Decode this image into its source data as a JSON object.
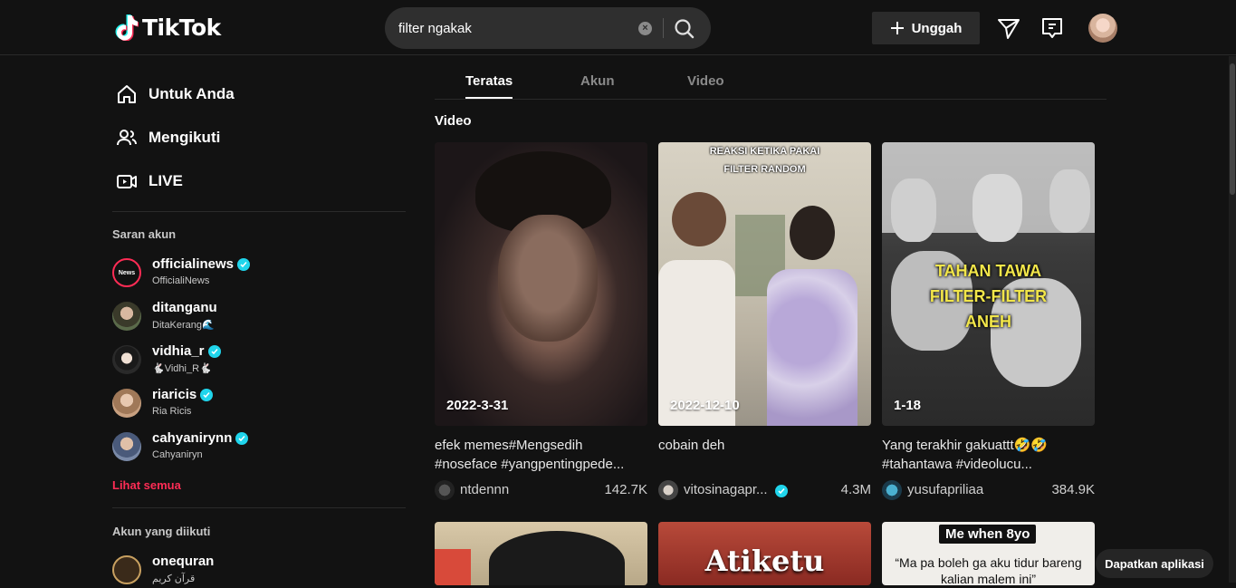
{
  "app": {
    "logo": "TikTok"
  },
  "search": {
    "value": "filter ngakak",
    "clear_icon": "×"
  },
  "header": {
    "upload_label": "Unggah"
  },
  "nav": [
    {
      "label": "Untuk Anda",
      "icon": "home-icon"
    },
    {
      "label": "Mengikuti",
      "icon": "users-icon"
    },
    {
      "label": "LIVE",
      "icon": "live-icon"
    }
  ],
  "suggested": {
    "title": "Saran akun",
    "accounts": [
      {
        "name": "officialinews",
        "sub": "OfficialiNews",
        "verified": true,
        "avatar_text": "News"
      },
      {
        "name": "ditanganu",
        "sub": "DitaKerang🌊",
        "verified": false
      },
      {
        "name": "vidhia_r",
        "sub": "🐇Vidhi_R🐇",
        "verified": true
      },
      {
        "name": "riaricis",
        "sub": "Ria Ricis",
        "verified": true
      },
      {
        "name": "cahyanirynn",
        "sub": "Cahyaniryn",
        "verified": true
      }
    ],
    "see_all": "Lihat semua"
  },
  "following": {
    "title": "Akun yang diikuti",
    "accounts": [
      {
        "name": "onequran",
        "sub": "قرآن كريم"
      }
    ]
  },
  "tabs": [
    "Teratas",
    "Akun",
    "Video"
  ],
  "section_title": "Video",
  "videos": [
    {
      "date": "2022-3-31",
      "desc": "efek memes#Mengsedih #noseface #yangpentingpede...",
      "author": "ntdennn",
      "count": "142.7K",
      "verified": false
    },
    {
      "date": "2022-12-10",
      "desc": "cobain deh",
      "author": "vitosinagapr...",
      "count": "4.3M",
      "verified": true,
      "overlay": "REAKSI KETIKA PAKAI FILTER RANDOM"
    },
    {
      "date": "1-18",
      "desc": "Yang terakhir gakuattt🤣🤣 #tahantawa #videolucu...",
      "author": "yusufapriliaa",
      "count": "384.9K",
      "verified": false,
      "overlay": "TAHAN TAWA FILTER-FILTER ANEH"
    }
  ],
  "videos_row2": [
    {
      "overlay": ""
    },
    {
      "overlay": "Atiketu"
    },
    {
      "overlay": "Me when 8yo",
      "caption": "“Ma pa boleh ga aku tidur bareng kalian malem ini”"
    }
  ],
  "get_app": "Dapatkan aplikasi"
}
